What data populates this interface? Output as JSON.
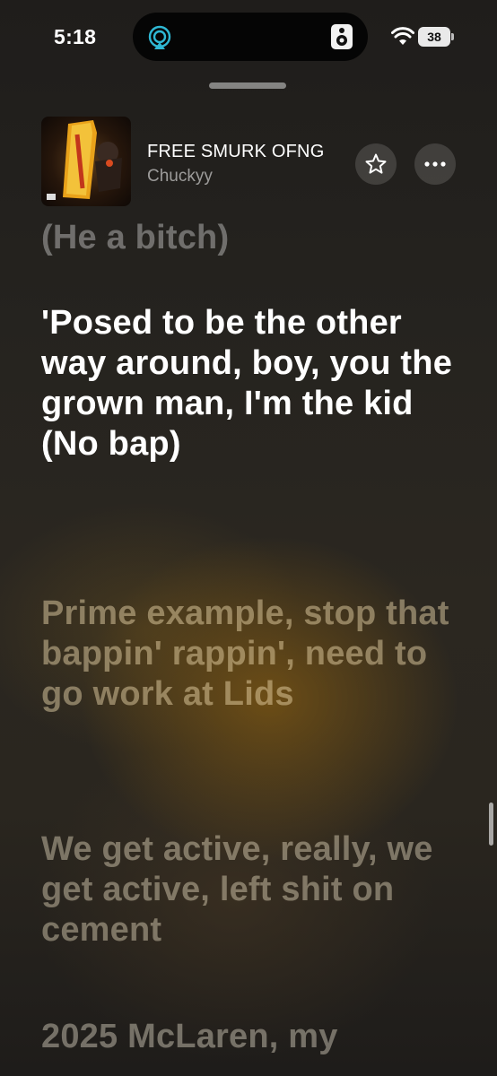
{
  "status_bar": {
    "time": "5:18",
    "battery": "38",
    "icons": [
      "airplay-audio-icon",
      "speaker-icon",
      "wifi-icon",
      "battery-icon"
    ]
  },
  "now_playing": {
    "title": "FREE SMURK OFNG",
    "artist": "Chuckyy",
    "buttons": [
      "star-icon",
      "more-icon"
    ]
  },
  "lyrics": {
    "previous": "(He a bitch)",
    "current": "'Posed to be the other way around, boy, you the grown man, I'm the kid (No bap)",
    "upcoming": [
      "Prime example, stop that bappin' rappin', need to go work at Lids",
      "We get active, really, we get active, left shit on cement",
      "2025 McLaren, my"
    ]
  },
  "colors": {
    "accent_gold": "#7a5414",
    "background": "#25231f",
    "current_lyric": "#ffffff"
  }
}
